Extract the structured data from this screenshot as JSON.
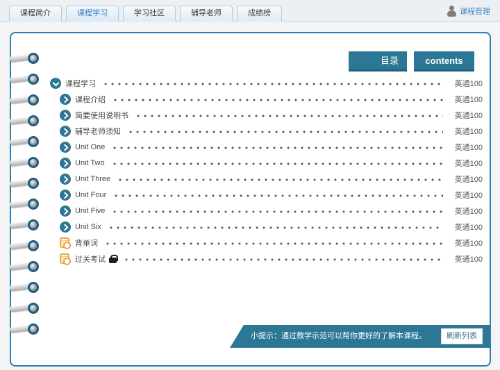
{
  "tabs": {
    "items": [
      {
        "label": "课程简介",
        "selected": false
      },
      {
        "label": "课程学习",
        "selected": true
      },
      {
        "label": "学习社区",
        "selected": false
      },
      {
        "label": "辅导老师",
        "selected": false
      },
      {
        "label": "成绩榜",
        "selected": false
      }
    ]
  },
  "header": {
    "manage_label": "课程管理",
    "manage_icon": "person-icon"
  },
  "toolbar": {
    "catalog_label": "目录",
    "contents_label": "contents"
  },
  "list": {
    "rows": [
      {
        "label": "课程学习",
        "value": "英通100",
        "icon": "chevron-down",
        "expanded": true
      },
      {
        "label": "课程介绍",
        "value": "英通100",
        "icon": "chevron-right"
      },
      {
        "label": "简要使用说明书",
        "value": "英通100",
        "icon": "chevron-right"
      },
      {
        "label": "辅导老师须知",
        "value": "英通100",
        "icon": "chevron-right"
      },
      {
        "label": "Unit One",
        "value": "英通100",
        "icon": "chevron-right"
      },
      {
        "label": "Unit Two",
        "value": "英通100",
        "icon": "chevron-right"
      },
      {
        "label": "Unit Three",
        "value": "英通100",
        "icon": "chevron-right"
      },
      {
        "label": "Unit Four",
        "value": "英通100",
        "icon": "chevron-right"
      },
      {
        "label": "Unit Five",
        "value": "英通100",
        "icon": "chevron-right"
      },
      {
        "label": "Unit Six",
        "value": "英通100",
        "icon": "chevron-right"
      },
      {
        "label": "背单词",
        "value": "英通100",
        "icon": "doc"
      },
      {
        "label": "过关考试",
        "value": "英通100",
        "icon": "doc",
        "locked": true,
        "lock_icon": "lock-icon"
      }
    ]
  },
  "tip": {
    "text": "小提示：通过教学示范可以帮你更好的了解本课程。",
    "refresh_label": "刷新列表"
  },
  "colors": {
    "accent_teal": "#2b7795",
    "panel_border_blue": "#2f7cad",
    "link_blue": "#3b82c4",
    "doc_icon_orange": "#e9a83f",
    "dot_leader": "#33576d"
  }
}
